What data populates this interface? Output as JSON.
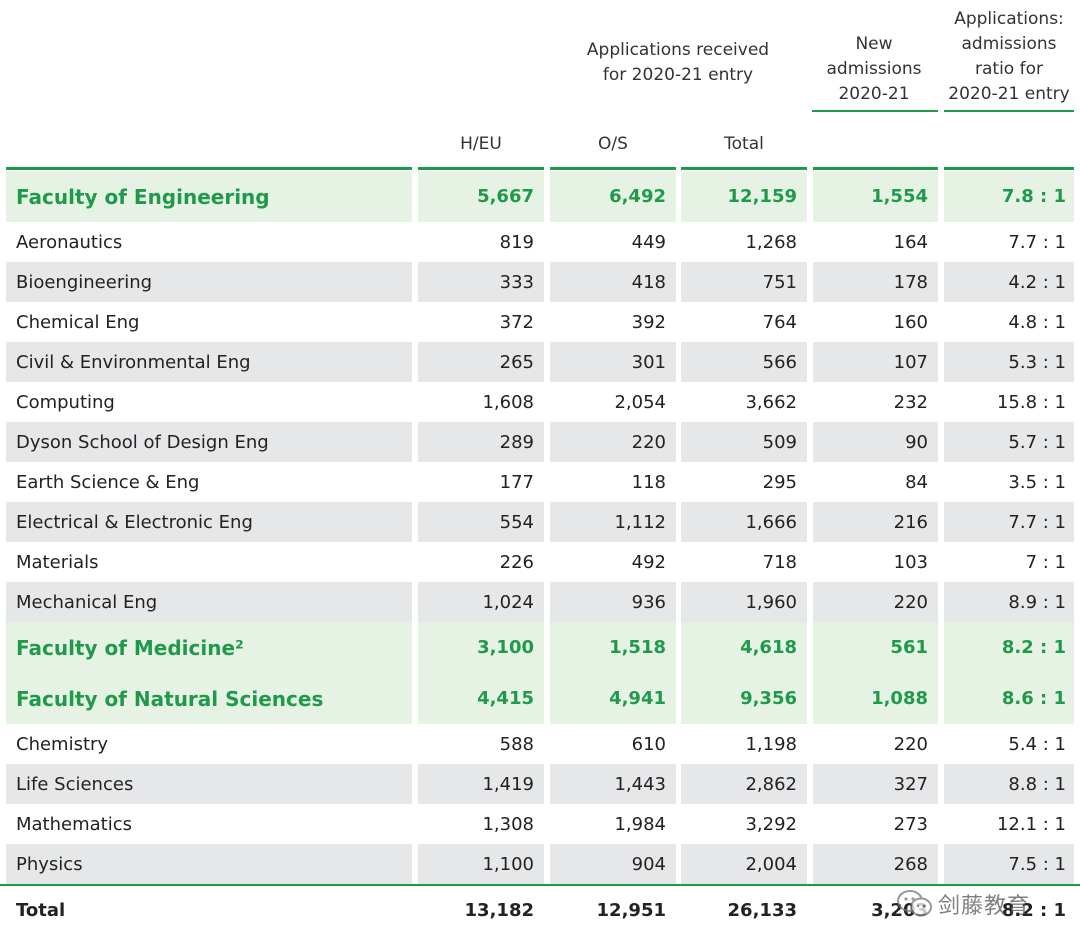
{
  "header": {
    "applications_group": [
      "Applications received",
      "for 2020-21 entry"
    ],
    "new_admissions": [
      "New",
      "admissions",
      "2020-21"
    ],
    "ratio": [
      "Applications:",
      "admissions",
      "ratio for",
      "2020-21 entry"
    ],
    "col_heu": "H/EU",
    "col_os": "O/S",
    "col_total": "Total"
  },
  "rows": [
    {
      "type": "faculty",
      "name": "Faculty of Engineering",
      "heu": "5,667",
      "os": "6,492",
      "total": "12,159",
      "new": "1,554",
      "ratio": "7.8 : 1"
    },
    {
      "type": "dept",
      "name": "Aeronautics",
      "heu": "819",
      "os": "449",
      "total": "1,268",
      "new": "164",
      "ratio": "7.7 : 1"
    },
    {
      "type": "dept",
      "name": "Bioengineering",
      "heu": "333",
      "os": "418",
      "total": "751",
      "new": "178",
      "ratio": "4.2 : 1"
    },
    {
      "type": "dept",
      "name": "Chemical Eng",
      "heu": "372",
      "os": "392",
      "total": "764",
      "new": "160",
      "ratio": "4.8 : 1"
    },
    {
      "type": "dept",
      "name": "Civil & Environmental Eng",
      "heu": "265",
      "os": "301",
      "total": "566",
      "new": "107",
      "ratio": "5.3 : 1"
    },
    {
      "type": "dept",
      "name": "Computing",
      "heu": "1,608",
      "os": "2,054",
      "total": "3,662",
      "new": "232",
      "ratio": "15.8 : 1"
    },
    {
      "type": "dept",
      "name": "Dyson School of Design Eng",
      "heu": "289",
      "os": "220",
      "total": "509",
      "new": "90",
      "ratio": "5.7 : 1"
    },
    {
      "type": "dept",
      "name": "Earth Science & Eng",
      "heu": "177",
      "os": "118",
      "total": "295",
      "new": "84",
      "ratio": "3.5 : 1"
    },
    {
      "type": "dept",
      "name": "Electrical & Electronic Eng",
      "heu": "554",
      "os": "1,112",
      "total": "1,666",
      "new": "216",
      "ratio": "7.7 : 1"
    },
    {
      "type": "dept",
      "name": "Materials",
      "heu": "226",
      "os": "492",
      "total": "718",
      "new": "103",
      "ratio": "7 : 1"
    },
    {
      "type": "dept",
      "name": "Mechanical Eng",
      "heu": "1,024",
      "os": "936",
      "total": "1,960",
      "new": "220",
      "ratio": "8.9 : 1"
    },
    {
      "type": "faculty",
      "name": "Faculty of Medicine²",
      "heu": "3,100",
      "os": "1,518",
      "total": "4,618",
      "new": "561",
      "ratio": "8.2 : 1"
    },
    {
      "type": "faculty",
      "name": "Faculty of Natural Sciences",
      "heu": "4,415",
      "os": "4,941",
      "total": "9,356",
      "new": "1,088",
      "ratio": "8.6 : 1"
    },
    {
      "type": "dept",
      "name": "Chemistry",
      "heu": "588",
      "os": "610",
      "total": "1,198",
      "new": "220",
      "ratio": "5.4 : 1"
    },
    {
      "type": "dept",
      "name": "Life Sciences",
      "heu": "1,419",
      "os": "1,443",
      "total": "2,862",
      "new": "327",
      "ratio": "8.8 : 1"
    },
    {
      "type": "dept",
      "name": "Mathematics",
      "heu": "1,308",
      "os": "1,984",
      "total": "3,292",
      "new": "273",
      "ratio": "12.1 : 1"
    },
    {
      "type": "dept",
      "name": "Physics",
      "heu": "1,100",
      "os": "904",
      "total": "2,004",
      "new": "268",
      "ratio": "7.5 : 1"
    },
    {
      "type": "total",
      "name": "Total",
      "heu": "13,182",
      "os": "12,951",
      "total": "26,133",
      "new": "3,203",
      "ratio": "8.2 : 1"
    }
  ],
  "watermark": {
    "text": "剑藤教育",
    "icon": "wechat-icon"
  },
  "colors": {
    "accent_green": "#1f9a4b",
    "faculty_bg": "#e6f3e4",
    "shade_bg": "#e6e7e9"
  }
}
